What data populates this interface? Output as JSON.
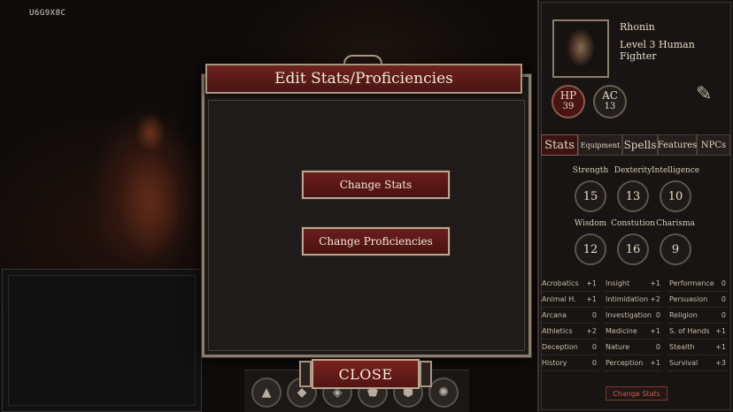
{
  "overlay": {
    "code": "U6G9X8C"
  },
  "modal": {
    "title": "Edit Stats/Proficiencies",
    "change_stats": "Change Stats",
    "change_proficiencies": "Change Proficiencies",
    "close": "CLOSE"
  },
  "character": {
    "name": "Rhonin",
    "level": "Level 3 Human Fighter",
    "hp_label": "HP",
    "hp_value": "39",
    "ac_label": "AC",
    "ac_value": "13"
  },
  "tabs": [
    "Stats",
    "Equipment",
    "Spells",
    "Features",
    "NPCs"
  ],
  "stats": [
    {
      "label": "Strength",
      "value": "15"
    },
    {
      "label": "Dexterity",
      "value": "13"
    },
    {
      "label": "Intelligence",
      "value": "10"
    },
    {
      "label": "Wisdom",
      "value": "12"
    },
    {
      "label": "Constution",
      "value": "16"
    },
    {
      "label": "Charisma",
      "value": "9"
    }
  ],
  "skills": [
    {
      "name": "Acrobatics",
      "value": "+1"
    },
    {
      "name": "Insight",
      "value": "+1"
    },
    {
      "name": "Performance",
      "value": "0"
    },
    {
      "name": "Animal H.",
      "value": "+1"
    },
    {
      "name": "Intimidation",
      "value": "+2"
    },
    {
      "name": "Persuasion",
      "value": "0"
    },
    {
      "name": "Arcana",
      "value": "0"
    },
    {
      "name": "Investigation",
      "value": "0"
    },
    {
      "name": "Religion",
      "value": "0"
    },
    {
      "name": "Athletics",
      "value": "+2"
    },
    {
      "name": "Medicine",
      "value": "+1"
    },
    {
      "name": "S. of Hands",
      "value": "+1"
    },
    {
      "name": "Deception",
      "value": "0"
    },
    {
      "name": "Nature",
      "value": "0"
    },
    {
      "name": "Stealth",
      "value": "+1"
    },
    {
      "name": "History",
      "value": "0"
    },
    {
      "name": "Perception",
      "value": "+1"
    },
    {
      "name": "Survival",
      "value": "+3"
    }
  ],
  "side": {
    "change_stats": "Change Stats"
  },
  "action_bar": {
    "icons": [
      "triangle-icon",
      "cube-icon",
      "octahedron-icon",
      "dodecahedron-icon",
      "icosahedron-icon",
      "d20-icon"
    ]
  }
}
